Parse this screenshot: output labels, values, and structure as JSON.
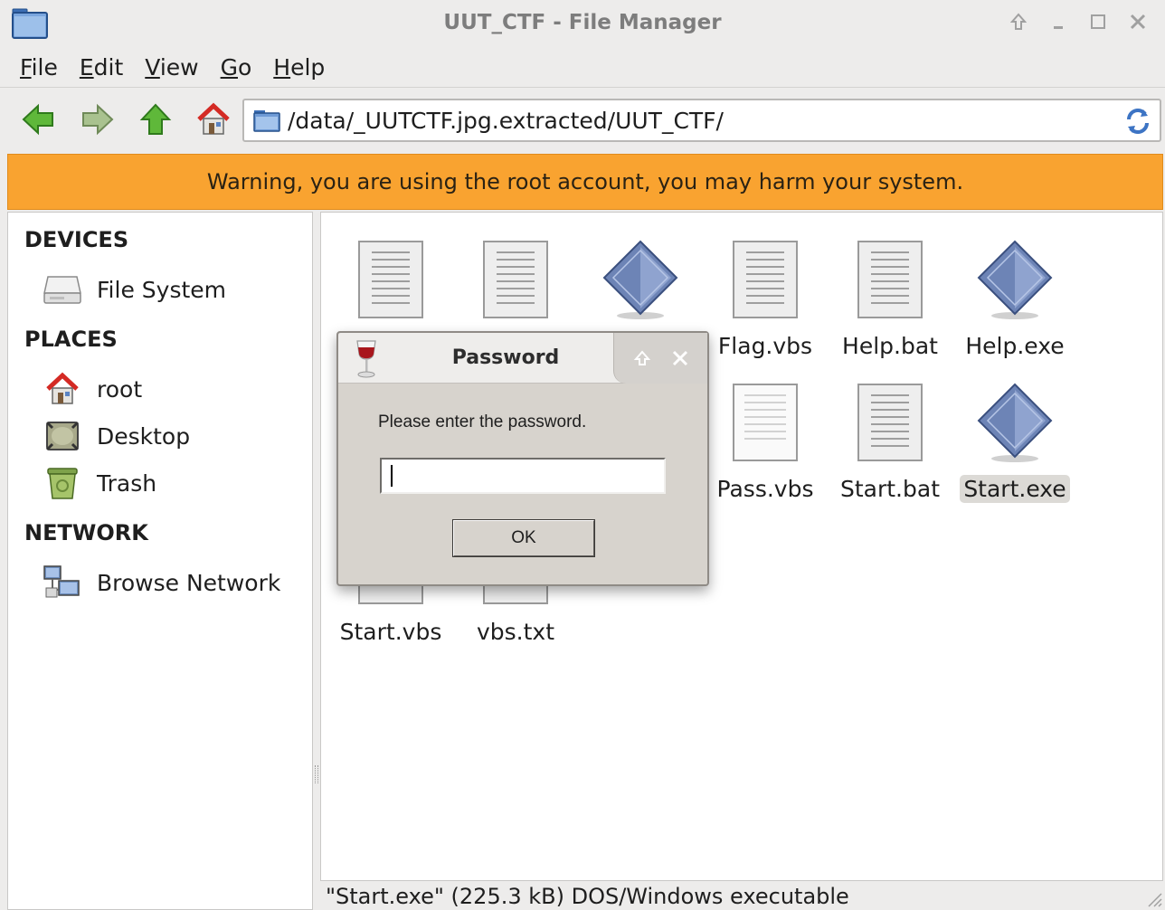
{
  "window": {
    "title": "UUT_CTF - File Manager"
  },
  "menu": [
    {
      "label": "File",
      "accel": "F",
      "rest": "ile"
    },
    {
      "label": "Edit",
      "accel": "E",
      "rest": "dit"
    },
    {
      "label": "View",
      "accel": "V",
      "rest": "iew"
    },
    {
      "label": "Go",
      "accel": "G",
      "rest": "o"
    },
    {
      "label": "Help",
      "accel": "H",
      "rest": "elp"
    }
  ],
  "location": {
    "path": "/data/_UUTCTF.jpg.extracted/UUT_CTF/"
  },
  "warning": {
    "text": "Warning, you are using the root account, you may harm your system.",
    "color": "#f9a330"
  },
  "sidebar": {
    "devices_heading": "DEVICES",
    "devices": [
      {
        "label": "File System",
        "icon": "drive-icon"
      }
    ],
    "places_heading": "PLACES",
    "places": [
      {
        "label": "root",
        "icon": "home-icon"
      },
      {
        "label": "Desktop",
        "icon": "desktop-icon"
      },
      {
        "label": "Trash",
        "icon": "trash-icon"
      }
    ],
    "network_heading": "NETWORK",
    "network": [
      {
        "label": "Browse Network",
        "icon": "network-icon"
      }
    ]
  },
  "files": [
    {
      "name": "Flag.vbs",
      "icon": "text-file-icon"
    },
    {
      "name": "Help.bat",
      "icon": "text-file-icon"
    },
    {
      "name": "Help.exe",
      "icon": "executable-icon"
    },
    {
      "name": "Pass.vbs",
      "icon": "blank-file-icon"
    },
    {
      "name": "Start.bat",
      "icon": "text-file-icon"
    },
    {
      "name": "Start.exe",
      "icon": "executable-icon",
      "selected": true
    },
    {
      "name": "Start.vbs",
      "icon": "text-file-icon"
    },
    {
      "name": "vbs.txt",
      "icon": "text-file-icon"
    }
  ],
  "status": {
    "text": "\"Start.exe\" (225.3 kB) DOS/Windows executable"
  },
  "dialog": {
    "title": "Password",
    "message": "Please enter the password.",
    "input_value": "",
    "ok_label": "OK"
  }
}
